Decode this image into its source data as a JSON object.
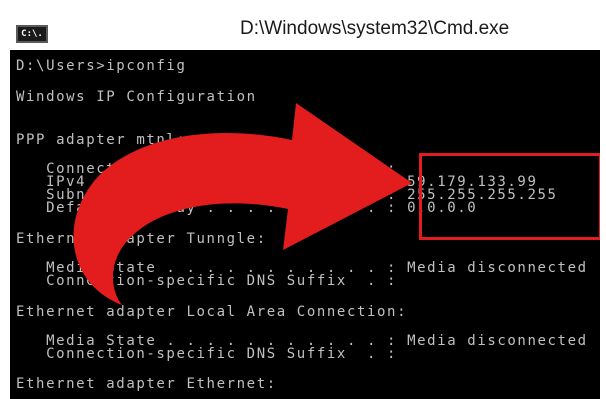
{
  "window": {
    "title": "D:\\Windows\\system32\\Cmd.exe",
    "icon": "console-app-icon",
    "icon_text": "C:\\."
  },
  "console": {
    "lines": [
      "D:\\Users>ipconfig",
      "Windows IP Configuration",
      "PPP adapter mtnl:",
      "   Connection-specific DNS Suffix  . :",
      "   IPv4 Address. . . . . . . . . . . : 59.179.133.99",
      "   Subnet Mask . . . . . . . . . . . : 255.255.255.255",
      "   Default Gateway . . . . . . . . . : 0.0.0.0",
      "Ethernet adapter Tunngle:",
      "   Media State . . . . . . . . . . . : Media disconnected",
      "   Connection-specific DNS Suffix  . :",
      "Ethernet adapter Local Area Connection:",
      "   Media State . . . . . . . . . . . : Media disconnected",
      "   Connection-specific DNS Suffix  . :",
      "Ethernet adapter Ethernet:"
    ],
    "text_color": "#c0c0c0",
    "background_color": "#000000"
  },
  "annotation": {
    "arrow_color": "#e31d1d",
    "box_color": "#e31d1d"
  }
}
